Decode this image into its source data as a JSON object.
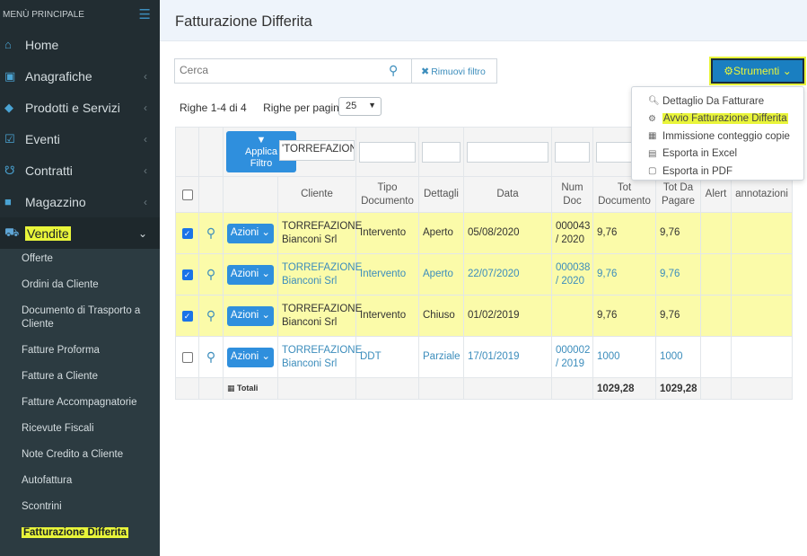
{
  "sidebar": {
    "header": "MENÙ PRINCIPALE",
    "items": [
      {
        "label": "Home",
        "icon": "home-icon",
        "glyph": "⌂",
        "arrow": ""
      },
      {
        "label": "Anagrafiche",
        "icon": "id-card-icon",
        "glyph": "▣",
        "arrow": "‹"
      },
      {
        "label": "Prodotti e Servizi",
        "icon": "tag-icon",
        "glyph": "◆",
        "arrow": "‹"
      },
      {
        "label": "Eventi",
        "icon": "calendar-check-icon",
        "glyph": "☑",
        "arrow": "‹"
      },
      {
        "label": "Contratti",
        "icon": "handshake-icon",
        "glyph": "☋",
        "arrow": "‹"
      },
      {
        "label": "Magazzino",
        "icon": "truck-icon",
        "glyph": "■",
        "arrow": "‹"
      },
      {
        "label": "Vendite",
        "icon": "basket-icon",
        "glyph": "⛟",
        "arrow": "⌄"
      }
    ],
    "submenu": [
      "Offerte",
      "Ordini da Cliente",
      "Documento di Trasporto a Cliente",
      "Fatture Proforma",
      "Fatture a Cliente",
      "Fatture Accompagnatorie",
      "Ricevute Fiscali",
      "Note Credito a Cliente",
      "Autofattura",
      "Scontrini",
      "Fatturazione Differita"
    ]
  },
  "page": {
    "title": "Fatturazione Differita"
  },
  "search": {
    "placeholder": "Cerca",
    "clear_label": "Rimuovi filtro"
  },
  "toolbar": {
    "strumenti_label": "Strumenti"
  },
  "pager": {
    "range": "Righe 1-4 di 4",
    "rows_per_page_label": "Righe per pagina",
    "rows_per_page_value": "25"
  },
  "dropdown": {
    "items": [
      {
        "label": "Dettaglio Da Fatturare",
        "icon": "search-icon"
      },
      {
        "label": "Avvio Fatturazione Differita",
        "icon": "gear-icon"
      },
      {
        "label": "Immissione conteggio copie",
        "icon": "calculator-icon"
      },
      {
        "label": "Esporta in Excel",
        "icon": "file-excel-icon"
      },
      {
        "label": "Esporta in PDF",
        "icon": "file-pdf-icon"
      }
    ]
  },
  "filters": {
    "apply_label_1": "Applica",
    "apply_label_2": "Filtro",
    "cliente_value": "'TORREFAZION"
  },
  "columns": [
    "Cliente",
    "Tipo Documento",
    "Dettagli",
    "Data",
    "Num Doc",
    "Tot Documento",
    "Tot Da Pagare",
    "Alert",
    "annotazioni"
  ],
  "rows": [
    {
      "checked": true,
      "action": "Azioni",
      "cliente": "TORREFAZIONE Bianconi Srl",
      "tipo": "Intervento",
      "dettagli": "Aperto",
      "data": "05/08/2020",
      "num": "000043 / 2020",
      "tot_doc": "9,76",
      "tot_pagare": "9,76",
      "alert": "",
      "note": ""
    },
    {
      "checked": true,
      "action": "Azioni",
      "cliente": "TORREFAZIONE Bianconi Srl",
      "tipo": "Intervento",
      "dettagli": "Aperto",
      "data": "22/07/2020",
      "num": "000038 / 2020",
      "tot_doc": "9,76",
      "tot_pagare": "9,76",
      "alert": "",
      "note": ""
    },
    {
      "checked": true,
      "action": "Azioni",
      "cliente": "TORREFAZIONE Bianconi Srl",
      "tipo": "Intervento",
      "dettagli": "Chiuso",
      "data": "01/02/2019",
      "num": "",
      "tot_doc": "9,76",
      "tot_pagare": "9,76",
      "alert": "",
      "note": ""
    },
    {
      "checked": false,
      "action": "Azioni",
      "cliente": "TORREFAZIONE Bianconi Srl",
      "tipo": "DDT",
      "dettagli": "Parziale",
      "data": "17/01/2019",
      "num": "000002 / 2019",
      "tot_doc": "1000",
      "tot_pagare": "1000",
      "alert": "",
      "note": ""
    }
  ],
  "totals": {
    "label": "Totali",
    "tot_doc": "1029,28",
    "tot_pagare": "1029,28"
  },
  "colors": {
    "accent": "#3c8dbc",
    "button": "#2f8fdd",
    "highlight": "#e9f53a",
    "row_selected": "#fbfba9",
    "sidebar": "#222d32"
  }
}
